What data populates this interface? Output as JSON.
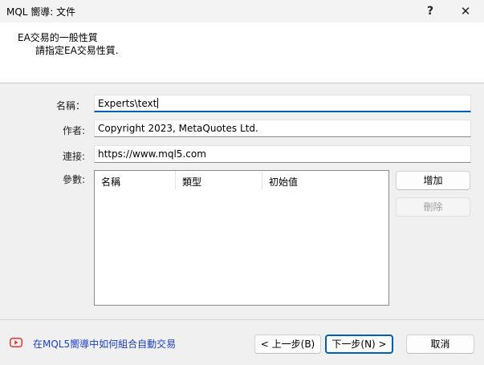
{
  "window": {
    "title": "MQL 嚮導: 文件",
    "help_glyph": "?",
    "close_glyph": "✕"
  },
  "header": {
    "title": "EA交易的一般性質",
    "subtitle": "請指定EA交易性質."
  },
  "form": {
    "name_label": "名稱：",
    "name_value": "Experts\\text",
    "author_label": "作者:",
    "author_value": "Copyright 2023, MetaQuotes Ltd.",
    "link_label": "連接:",
    "link_value": "https://www.mql5.com",
    "params_label": "參數:"
  },
  "params_table": {
    "columns": [
      "名稱",
      "類型",
      "初始值"
    ],
    "rows": []
  },
  "side_buttons": {
    "add": "增加",
    "delete": "刪除"
  },
  "footer": {
    "help_link": "在MQL5嚮導中如何組合自動交易",
    "back_button": "< 上一步(B)",
    "next_button": "下一步(N) >",
    "cancel_button": "取消"
  },
  "colors": {
    "accent": "#005fb8",
    "link": "#1c3fcc",
    "video_icon": "#e53935"
  }
}
